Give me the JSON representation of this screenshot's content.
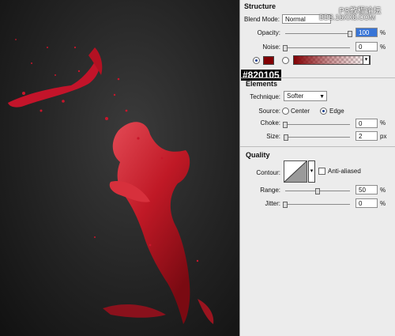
{
  "watermark": {
    "line1": "PS教程论坛",
    "line2": "BBS.16XX8.COM"
  },
  "structure": {
    "title": "Structure",
    "blend_mode_label": "Blend Mode:",
    "blend_mode_value": "Normal",
    "opacity_label": "Opacity:",
    "opacity_value": "100",
    "opacity_level": 100,
    "noise_label": "Noise:",
    "noise_value": "0",
    "noise_level": 0,
    "unit": "%",
    "color": "#820105",
    "color_hex_label": "#820105"
  },
  "elements": {
    "title": "Elements",
    "technique_label": "Technique:",
    "technique_value": "Softer",
    "source_label": "Source:",
    "source_center": "Center",
    "source_edge": "Edge",
    "source_selected": "Edge",
    "choke_label": "Choke:",
    "choke_value": "0",
    "choke_level": 0,
    "size_label": "Size:",
    "size_value": "2",
    "size_level": 2,
    "pct": "%",
    "px": "px"
  },
  "quality": {
    "title": "Quality",
    "contour_label": "Contour:",
    "anti_aliased_label": "Anti-aliased",
    "anti_aliased": false,
    "range_label": "Range:",
    "range_value": "50",
    "range_level": 50,
    "jitter_label": "Jitter:",
    "jitter_value": "0",
    "jitter_level": 0,
    "unit": "%"
  }
}
